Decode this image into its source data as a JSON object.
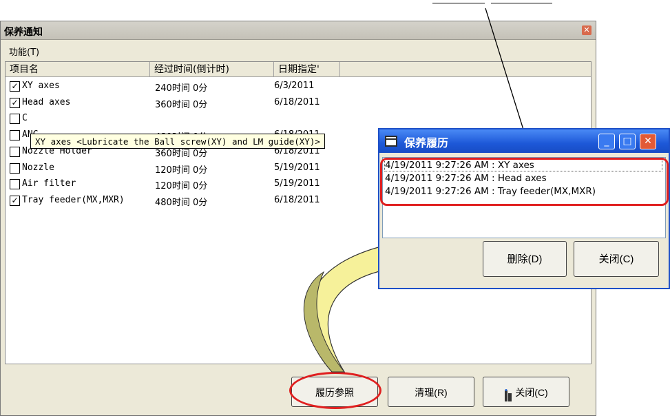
{
  "main_window": {
    "title": "保养通知",
    "menu": {
      "function_label": "功能(T)"
    },
    "columns": [
      "项目名",
      "经过时间(倒计时)",
      "日期指定'"
    ],
    "rows": [
      {
        "checked": true,
        "name": "XY axes",
        "time": "240时间 0分",
        "date": "6/3/2011"
      },
      {
        "checked": true,
        "name": "Head axes",
        "time": "360时间 0分",
        "date": "6/18/2011"
      },
      {
        "checked": false,
        "name": "C",
        "time": "",
        "date": ""
      },
      {
        "checked": false,
        "name": "ANC",
        "time": "480时间 0分",
        "date": "6/18/2011"
      },
      {
        "checked": false,
        "name": "Nozzle Holder",
        "time": "360时间 0分",
        "date": "6/18/2011"
      },
      {
        "checked": false,
        "name": "Nozzle",
        "time": "120时间 0分",
        "date": "5/19/2011"
      },
      {
        "checked": false,
        "name": "Air filter",
        "time": "120时间 0分",
        "date": "5/19/2011"
      },
      {
        "checked": true,
        "name": "Tray feeder(MX,MXR)",
        "time": "480时间 0分",
        "date": "6/18/2011"
      }
    ],
    "tooltip": "XY axes  <Lubricate the Ball screw(XY) and LM guide(XY)>",
    "buttons": {
      "history": "履历参照",
      "clear": "清理(R)",
      "close": "关闭(C)"
    }
  },
  "history_window": {
    "title": "保养履历",
    "entries": [
      "4/19/2011 9:27:26 AM : XY axes",
      "4/19/2011 9:27:26 AM : Head axes",
      "4/19/2011 9:27:26 AM : Tray feeder(MX,MXR)"
    ],
    "buttons": {
      "delete": "删除(D)",
      "close": "关闭(C)"
    },
    "controls": {
      "minimize": "_",
      "maximize": "□",
      "close": "✕"
    }
  },
  "colors": {
    "highlight_red": "#e02020",
    "arrow_fill": "#f6f19a",
    "titlebar_blue": "#1d58d8"
  }
}
